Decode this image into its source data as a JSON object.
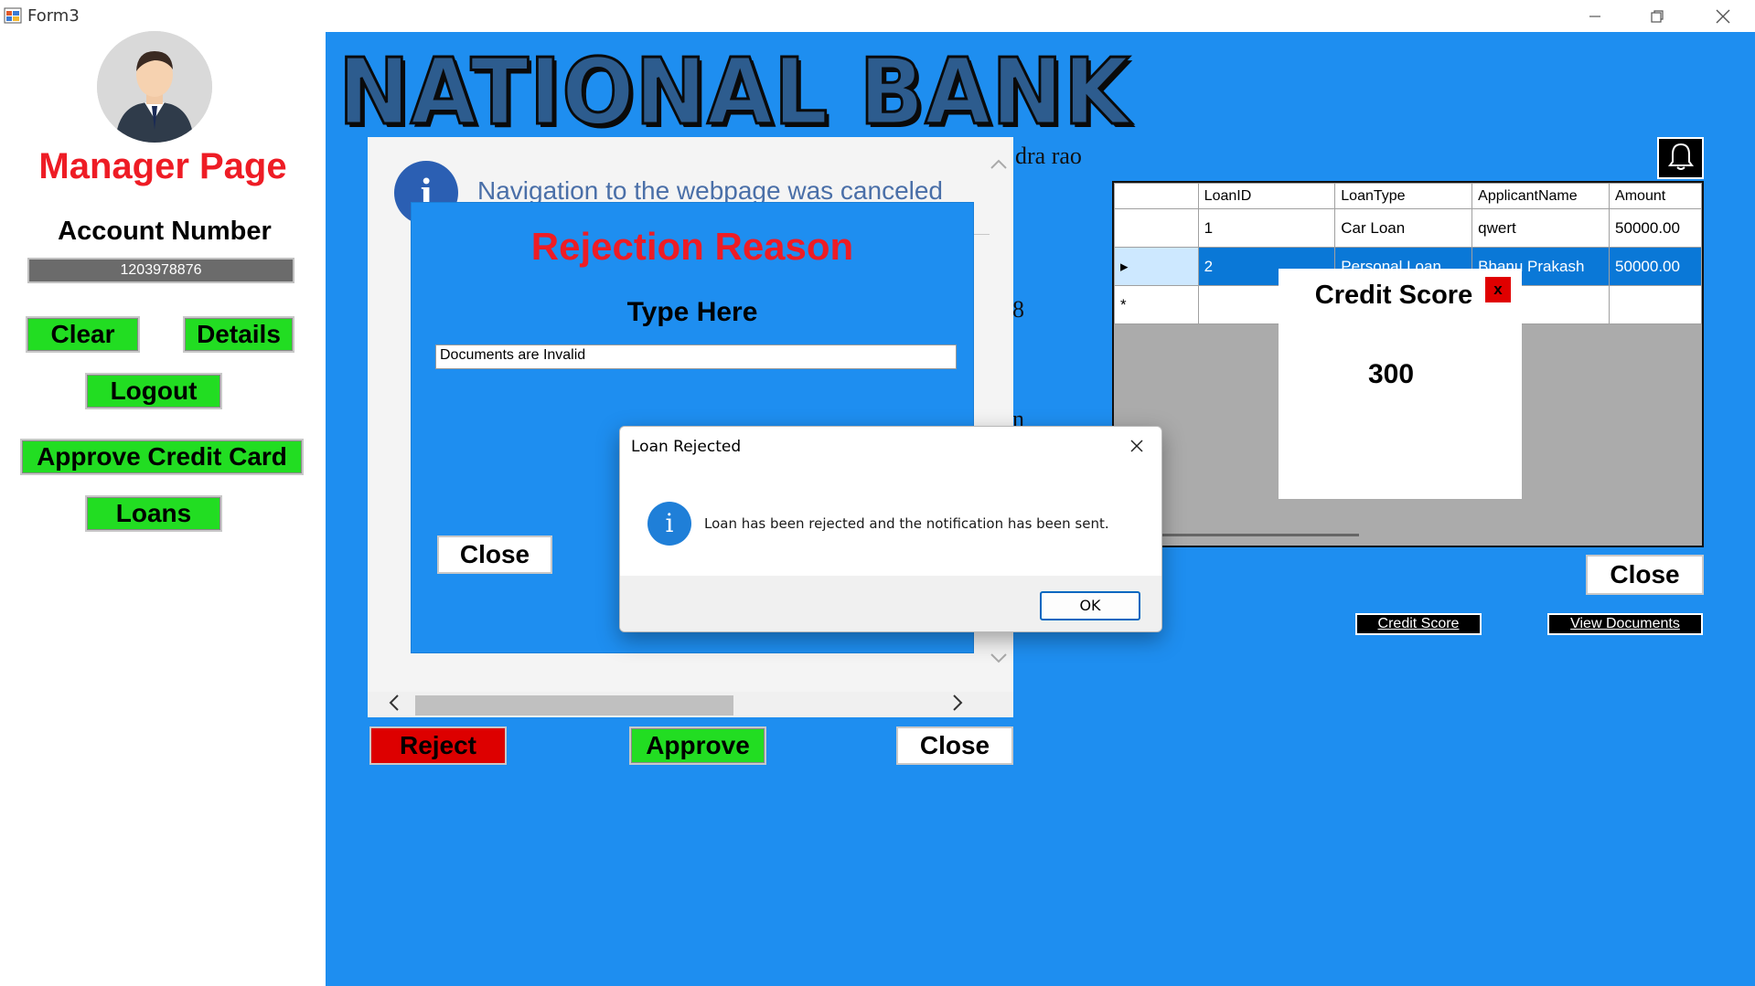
{
  "window": {
    "title": "Form3",
    "controls": [
      "minimize-icon",
      "restore-icon",
      "close-icon"
    ]
  },
  "sidebar": {
    "page_title": "Manager Page",
    "account_label": "Account Number",
    "account_number": "1203978876",
    "buttons": {
      "clear": "Clear",
      "details": "Details",
      "logout": "Logout",
      "approve_credit_card": "Approve Credit Card",
      "loans": "Loans"
    }
  },
  "header": {
    "bank_name": "NATIONAL BANK"
  },
  "browser": {
    "message": "Navigation to the webpage was canceled",
    "info_glyph": "i",
    "background_fragments": {
      "name_tail": "dra rao",
      "digit": "8",
      "letter": "n"
    }
  },
  "rejection_dialog": {
    "title": "Rejection Reason",
    "prompt": "Type Here",
    "reason_value": "Documents are Invalid",
    "close_label": "Close"
  },
  "loan_actions": {
    "reject": "Reject",
    "approve": "Approve",
    "close": "Close"
  },
  "loans_grid": {
    "columns": [
      "LoanID",
      "LoanType",
      "ApplicantName",
      "Amount"
    ],
    "rows": [
      {
        "indicator": "",
        "LoanID": "1",
        "LoanType": "Car Loan",
        "ApplicantName": "qwert",
        "Amount": "50000.00"
      },
      {
        "indicator": "▸",
        "LoanID": "2",
        "LoanType": "Personal Loan",
        "ApplicantName": "Bhanu Prakash",
        "Amount": "50000.00"
      },
      {
        "indicator": "*",
        "LoanID": "",
        "LoanType": "",
        "ApplicantName": "",
        "Amount": ""
      }
    ],
    "selected_row": 2
  },
  "credit_score_popup": {
    "title": "Credit Score",
    "close_glyph": "x",
    "score": "300"
  },
  "right_actions": {
    "close": "Close",
    "credit_score": "Credit Score",
    "view_documents": "View Documents"
  },
  "message_box": {
    "title": "Loan Rejected",
    "icon": "info-icon",
    "icon_glyph": "i",
    "text": "Loan has been rejected and the notification has been sent.",
    "ok_label": "OK"
  },
  "colors": {
    "main_blue": "#1e8ef0",
    "accent_red": "#ee1c25",
    "button_green": "#22dd22",
    "reject_red": "#dd0000",
    "selection_blue": "#0a78d7"
  }
}
